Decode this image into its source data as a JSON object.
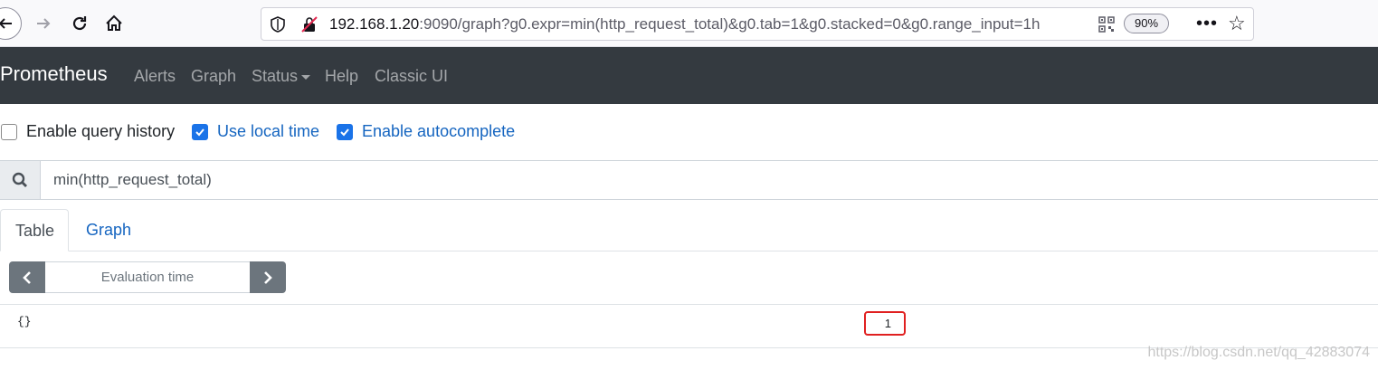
{
  "browser": {
    "url_host": "192.168.1.20",
    "url_rest": ":9090/graph?g0.expr=min(http_request_total)&g0.tab=1&g0.stacked=0&g0.range_input=1h",
    "zoom": "90%"
  },
  "navbar": {
    "brand": "Prometheus",
    "links": [
      "Alerts",
      "Graph",
      "Status",
      "Help",
      "Classic UI"
    ]
  },
  "options": {
    "query_history": {
      "label": "Enable query history",
      "checked": false
    },
    "local_time": {
      "label": "Use local time",
      "checked": true
    },
    "autocomplete": {
      "label": "Enable autocomplete",
      "checked": true
    }
  },
  "query": {
    "value": "min(http_request_total)"
  },
  "tabs": {
    "table": "Table",
    "graph": "Graph",
    "active": "Table"
  },
  "eval": {
    "placeholder": "Evaluation time"
  },
  "result": {
    "metric": "{}",
    "value": "1"
  },
  "watermark": "https://blog.csdn.net/qq_42883074",
  "colors": {
    "navbar": "#343a40",
    "link_blue": "#1565c0",
    "checkbox_blue": "#1a73e8",
    "highlight_red": "#e02020"
  }
}
